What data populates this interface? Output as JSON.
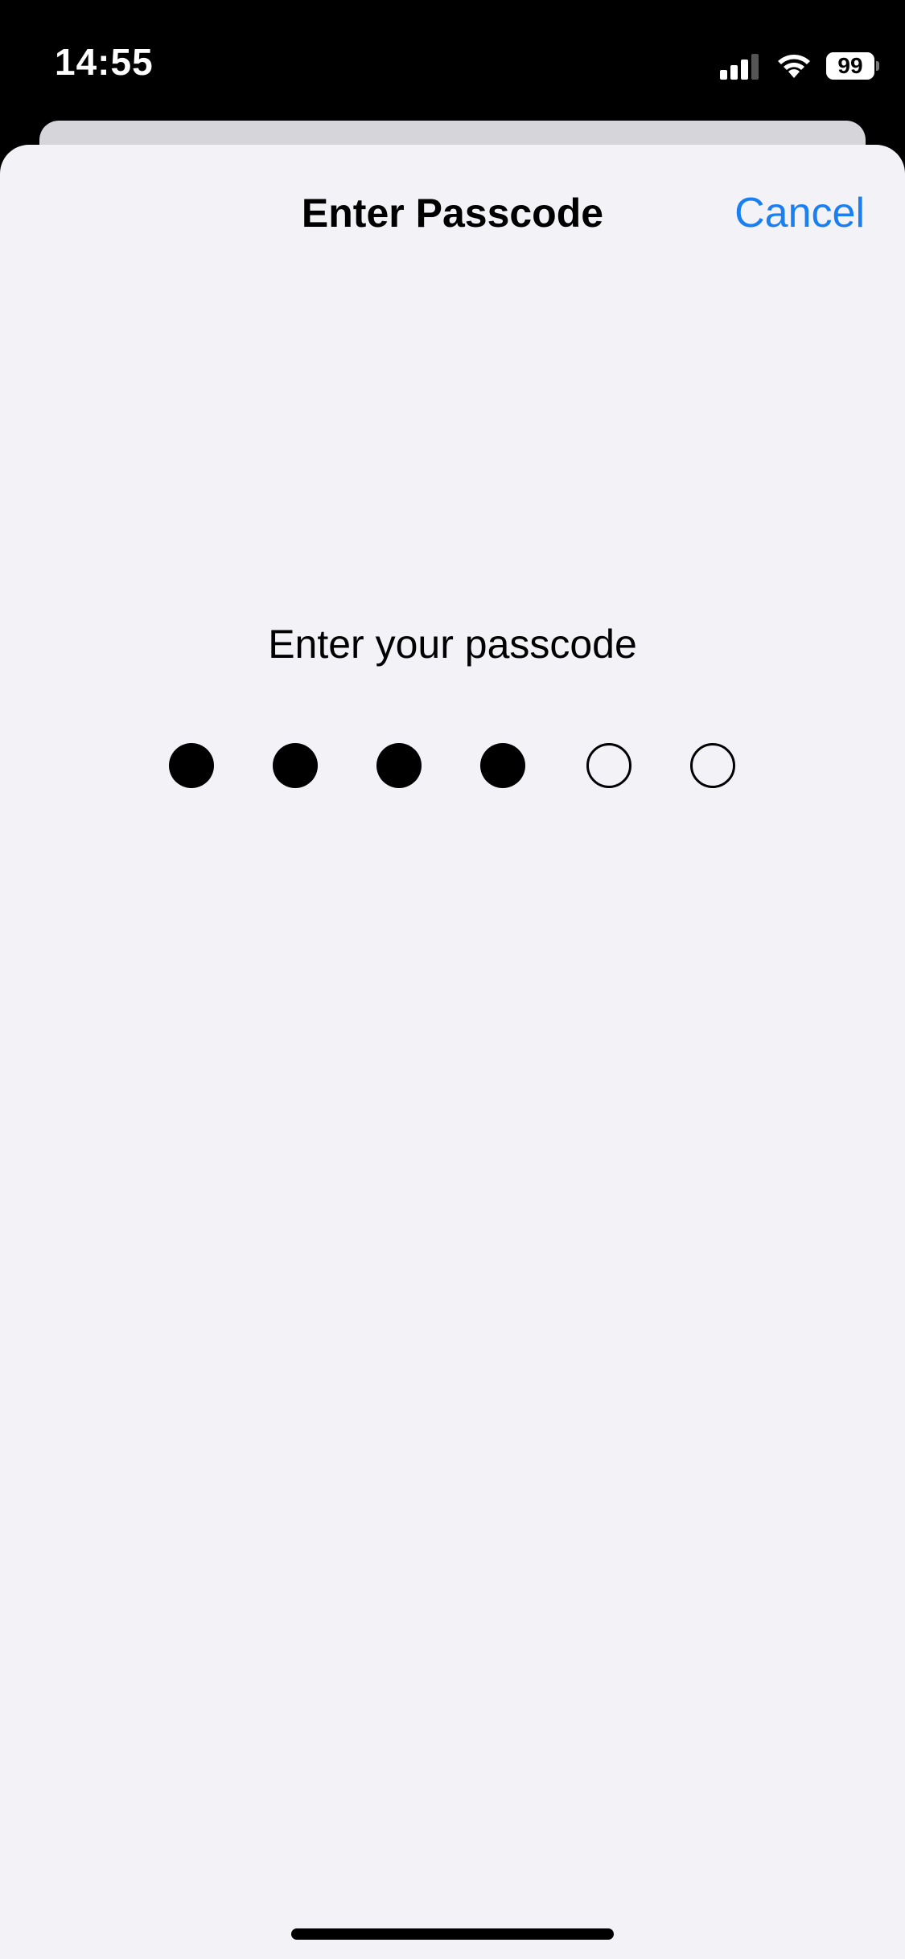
{
  "status_bar": {
    "time": "14:55",
    "battery": "99",
    "icons": [
      "cellular-signal-icon",
      "wifi-icon",
      "battery-icon"
    ]
  },
  "sheet": {
    "title": "Enter Passcode",
    "cancel_label": "Cancel"
  },
  "passcode": {
    "prompt": "Enter your passcode",
    "length": 6,
    "entered": 4
  },
  "colors": {
    "accent": "#1a7ff0",
    "sheet_background": "#f2f2f7",
    "dot": "#000000"
  }
}
